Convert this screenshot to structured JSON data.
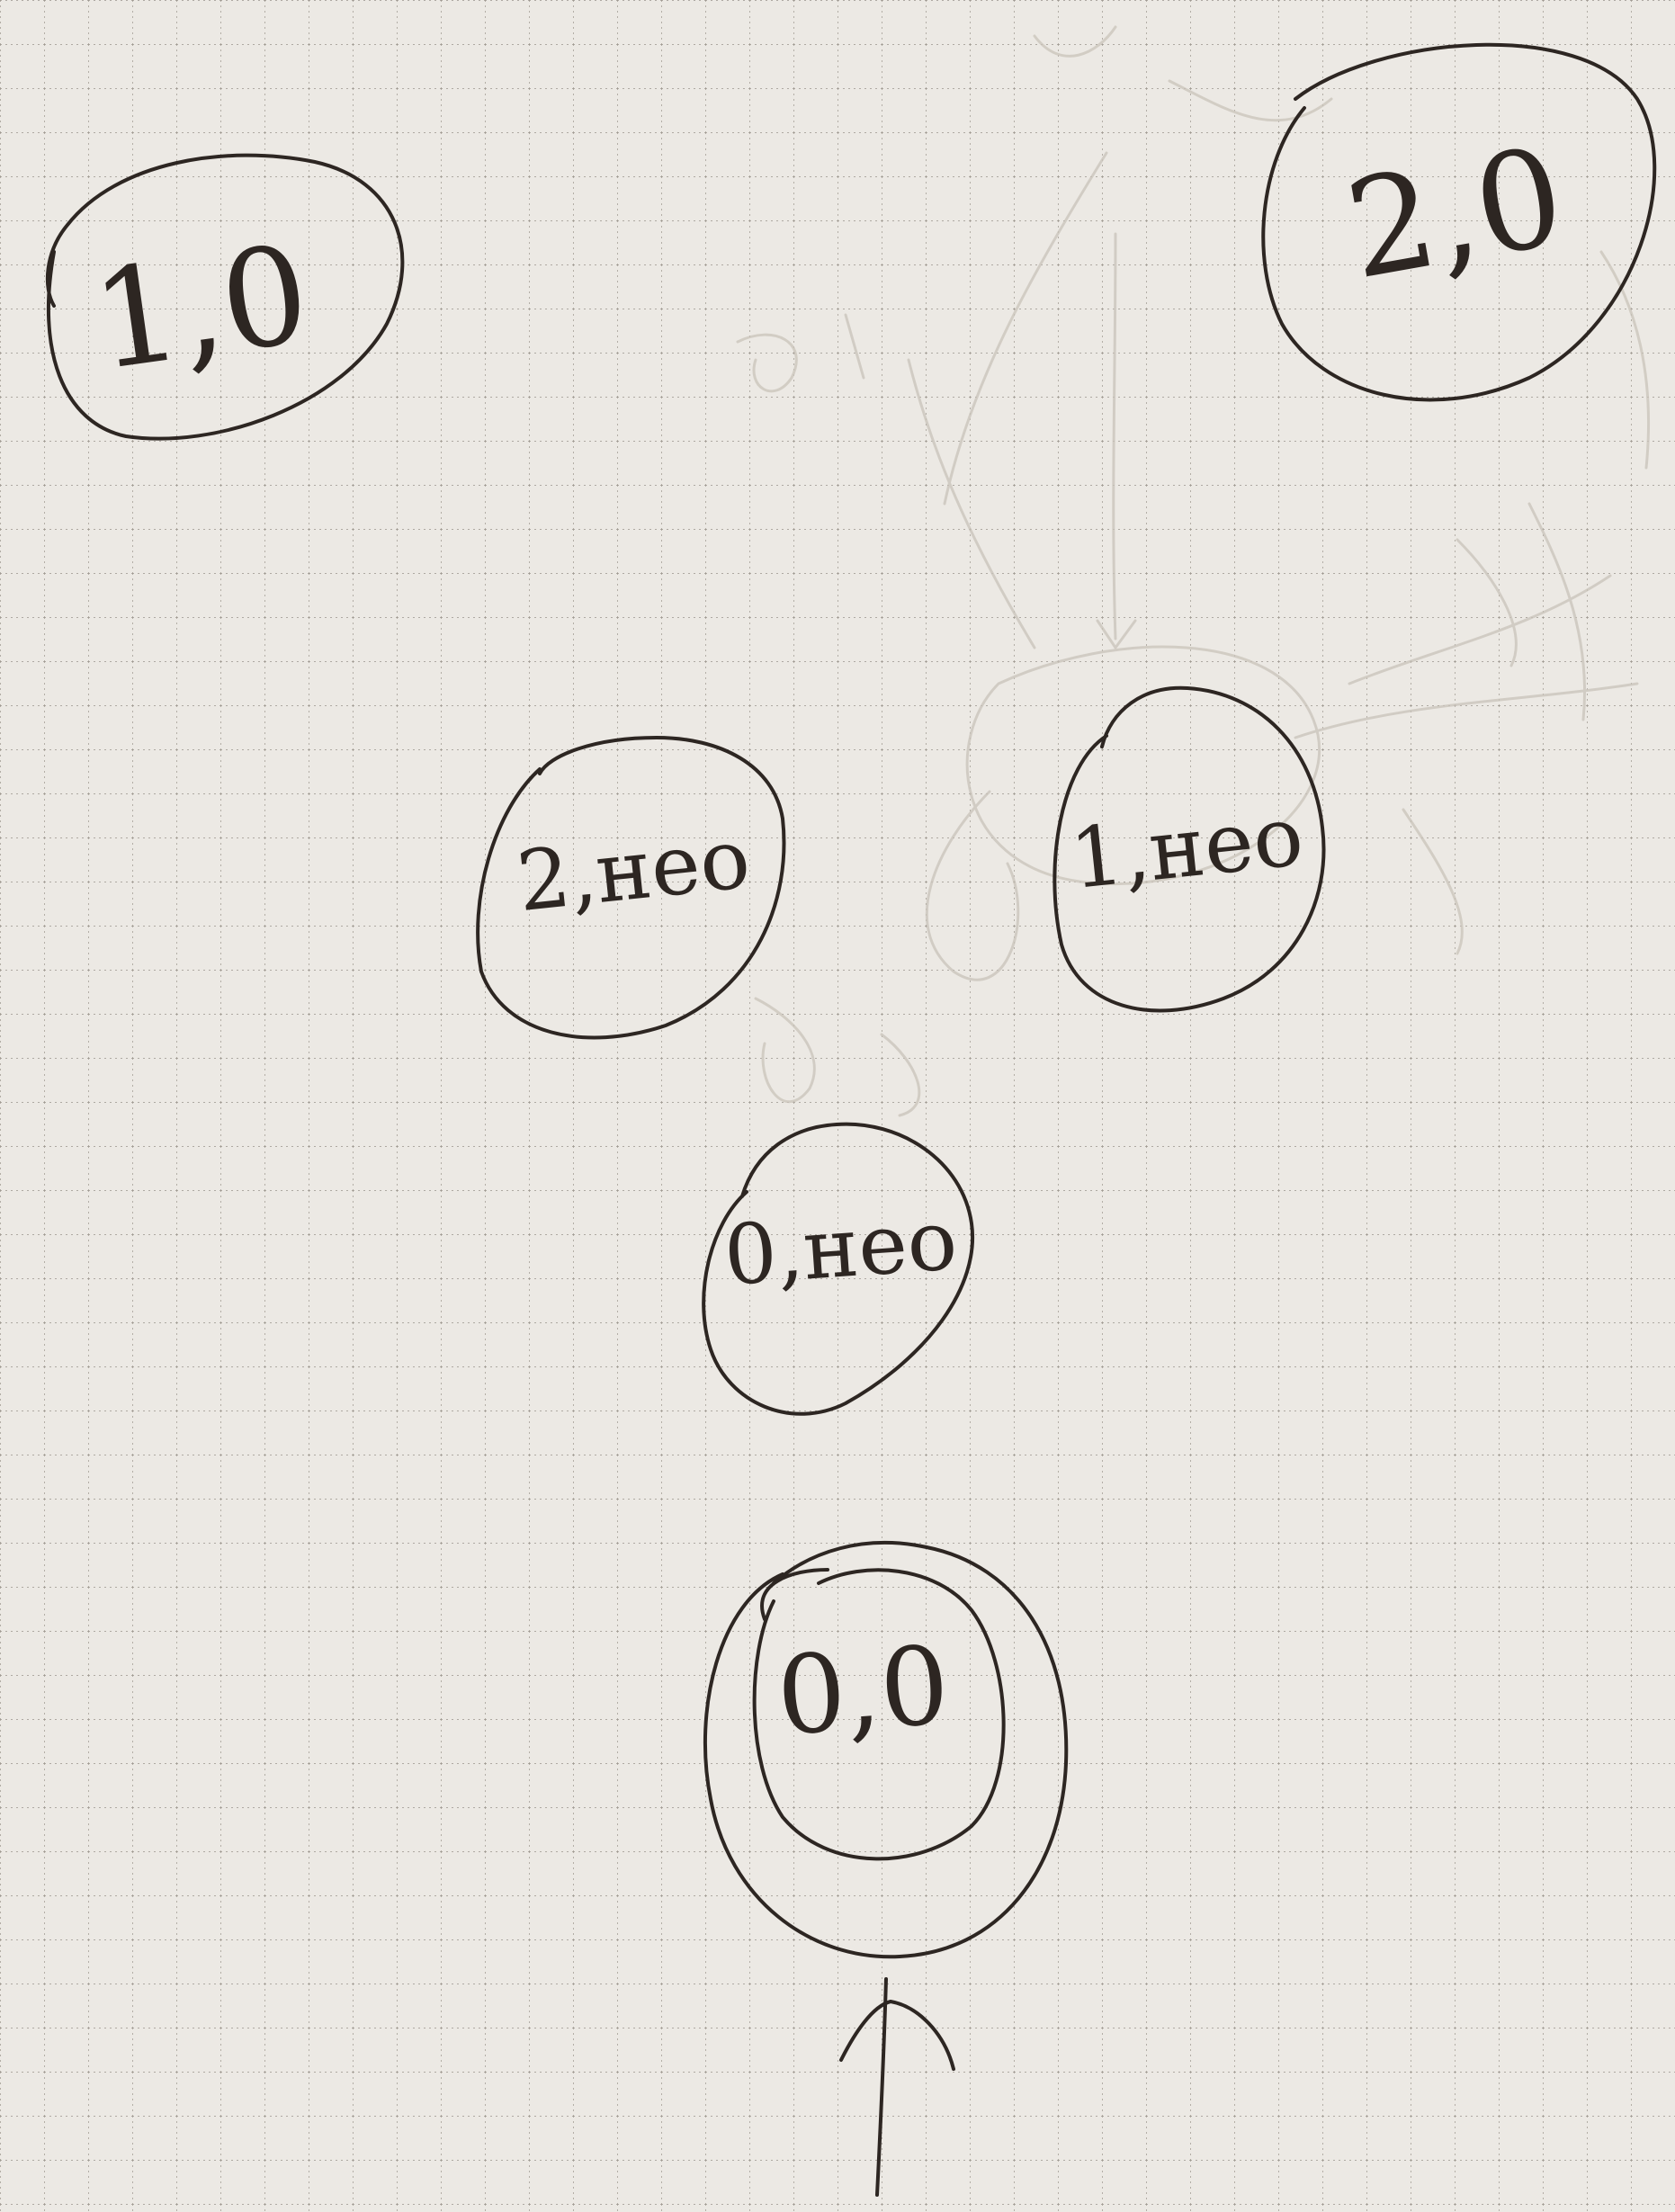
{
  "diagram": {
    "paper": {
      "background": "#ece9e4",
      "grid_color": "#9a948c",
      "ink_color": "#2d2622",
      "pencil_color": "#c9c3ba"
    },
    "states": [
      {
        "id": "state-1-0",
        "label": "1,0",
        "double_circle": false
      },
      {
        "id": "state-2-0",
        "label": "2,0",
        "double_circle": false
      },
      {
        "id": "state-2-neo",
        "label": "2,нео",
        "double_circle": false
      },
      {
        "id": "state-1-neo",
        "label": "1,нео",
        "double_circle": false
      },
      {
        "id": "state-0-neo",
        "label": "0,нео",
        "double_circle": false
      },
      {
        "id": "state-0-0",
        "label": "0,0",
        "double_circle": true,
        "initial": true
      }
    ],
    "initial_arrow_icon": "start-arrow-icon"
  }
}
